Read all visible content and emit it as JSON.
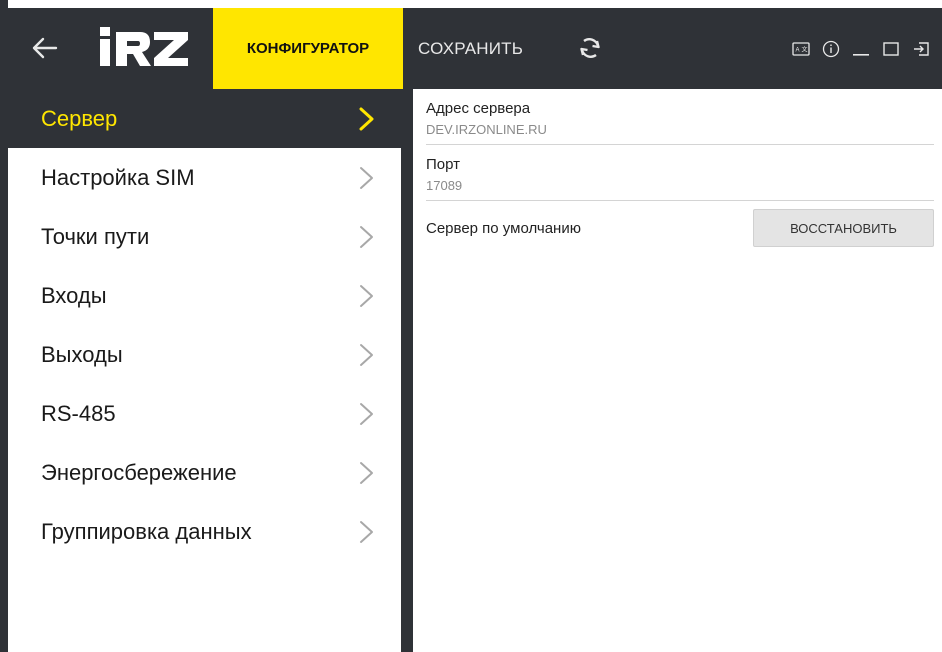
{
  "colors": {
    "bar": "#2f3237",
    "accent": "#ffe600",
    "active_text": "#ffe600"
  },
  "topbar": {
    "back_icon": "arrow-left-icon",
    "logo_text": "iRZ",
    "config_tab": "КОНФИГУРАТОР",
    "save_label": "СОХРАНИТЬ",
    "sync_icon": "sync-icon",
    "window_icons": [
      "keyboard-icon",
      "info-icon",
      "minimize-icon",
      "maximize-icon",
      "exit-icon"
    ]
  },
  "sidebar": {
    "items": [
      {
        "label": "Сервер",
        "active": true
      },
      {
        "label": "Настройка SIM",
        "active": false
      },
      {
        "label": "Точки пути",
        "active": false
      },
      {
        "label": "Входы",
        "active": false
      },
      {
        "label": "Выходы",
        "active": false
      },
      {
        "label": "RS-485",
        "active": false
      },
      {
        "label": "Энергосбережение",
        "active": false
      },
      {
        "label": "Группировка данных",
        "active": false
      }
    ]
  },
  "main": {
    "server_address": {
      "label": "Адрес сервера",
      "value": "DEV.IRZONLINE.RU"
    },
    "port": {
      "label": "Порт",
      "value": "17089"
    },
    "default_server": {
      "label": "Сервер по умолчанию",
      "button": "ВОССТАНОВИТЬ"
    }
  }
}
